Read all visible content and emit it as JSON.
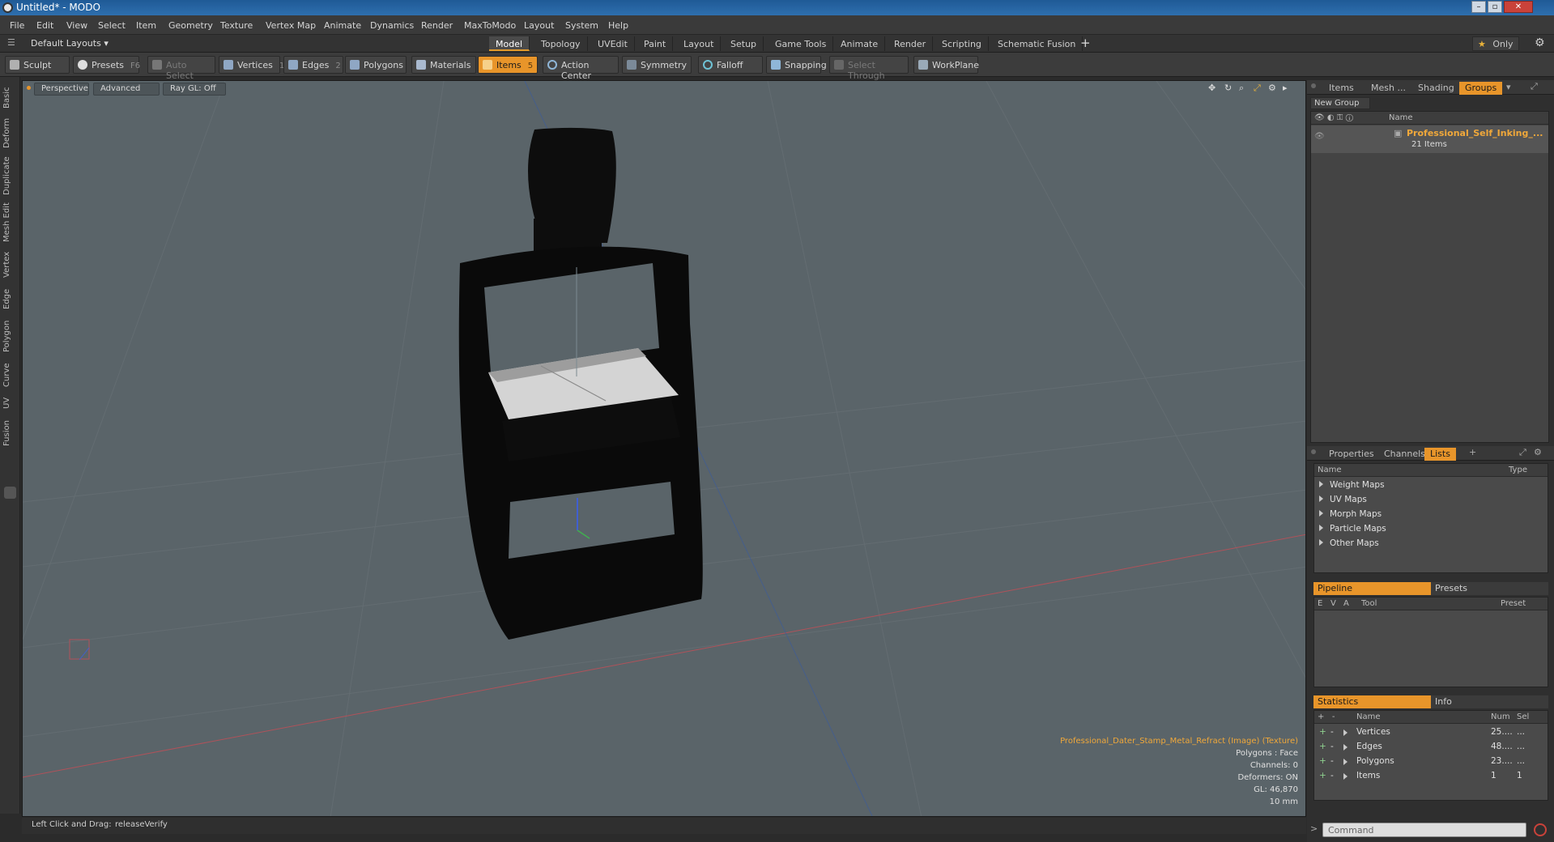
{
  "window": {
    "title": "Untitled* - MODO"
  },
  "menu": [
    "File",
    "Edit",
    "View",
    "Select",
    "Item",
    "Geometry",
    "Texture",
    "Vertex Map",
    "Animate",
    "Dynamics",
    "Render",
    "MaxToModo",
    "Layout",
    "System",
    "Help"
  ],
  "layout_selector": "Default Layouts",
  "layout_tabs": [
    {
      "label": "Model",
      "active": true
    },
    {
      "label": "Topology"
    },
    {
      "label": "UVEdit"
    },
    {
      "label": "Paint"
    },
    {
      "label": "Layout"
    },
    {
      "label": "Setup"
    },
    {
      "label": "Game Tools"
    },
    {
      "label": "Animate"
    },
    {
      "label": "Render"
    },
    {
      "label": "Scripting"
    },
    {
      "label": "Schematic Fusion"
    }
  ],
  "only_label": "Only",
  "toolbar": {
    "sculpt": "Sculpt",
    "presets": "Presets",
    "presets_key": "F6",
    "auto_select": "Auto Select",
    "vertices": "Vertices",
    "vertices_key": "1",
    "edges": "Edges",
    "edges_key": "2",
    "polygons": "Polygons",
    "materials": "Materials",
    "items": "Items",
    "items_key": "5",
    "action_center": "Action Center",
    "symmetry": "Symmetry",
    "falloff": "Falloff",
    "snapping": "Snapping",
    "select_through": "Select Through",
    "workplane": "WorkPlane"
  },
  "left_tabs": [
    "Basic",
    "Deform",
    "Duplicate",
    "Mesh Edit",
    "Vertex",
    "Edge",
    "Polygon",
    "Curve",
    "UV",
    "Fusion"
  ],
  "viewport": {
    "view_mode": "Perspective",
    "shading": "Advanced",
    "raygl": "Ray GL: Off",
    "info": {
      "texture": "Professional_Dater_Stamp_Metal_Refract (Image) (Texture)",
      "polygons": "Polygons : Face",
      "channels": "Channels: 0",
      "deformers": "Deformers: ON",
      "gl": "GL: 46,870",
      "scale": "10 mm"
    }
  },
  "status": {
    "hint_label": "Left Click and Drag:",
    "hint_value": "releaseVerify"
  },
  "groups_panel": {
    "tabs": [
      {
        "label": "Items"
      },
      {
        "label": "Mesh ..."
      },
      {
        "label": "Shading"
      },
      {
        "label": "Groups",
        "active": true
      }
    ],
    "new_group": "New Group",
    "col_name": "Name",
    "group_name": "Professional_Self_Inking_...",
    "group_count": "21 Items"
  },
  "lists_panel": {
    "tabs": [
      {
        "label": "Properties"
      },
      {
        "label": "Channels"
      },
      {
        "label": "Lists",
        "active": true
      }
    ],
    "col_name": "Name",
    "col_type": "Type",
    "items": [
      "Weight Maps",
      "UV Maps",
      "Morph Maps",
      "Particle Maps",
      "Other Maps"
    ]
  },
  "pipeline_panel": {
    "tab_active": "Pipeline",
    "tab_other": "Presets",
    "cols": [
      "E",
      "V",
      "A",
      "Tool",
      "Preset"
    ]
  },
  "stats_panel": {
    "tab_active": "Statistics",
    "tab_other": "Info",
    "cols": {
      "name": "Name",
      "num": "Num",
      "sel": "Sel"
    },
    "rows": [
      {
        "name": "Vertices",
        "num": "25....",
        "sel": "..."
      },
      {
        "name": "Edges",
        "num": "48....",
        "sel": "..."
      },
      {
        "name": "Polygons",
        "num": "23....",
        "sel": "..."
      },
      {
        "name": "Items",
        "num": "1",
        "sel": "1"
      }
    ]
  },
  "command_placeholder": "Command",
  "colors": {
    "accent": "#e8952a",
    "viewport_bg": "#5a6469",
    "info_orange": "#f0a83a"
  }
}
